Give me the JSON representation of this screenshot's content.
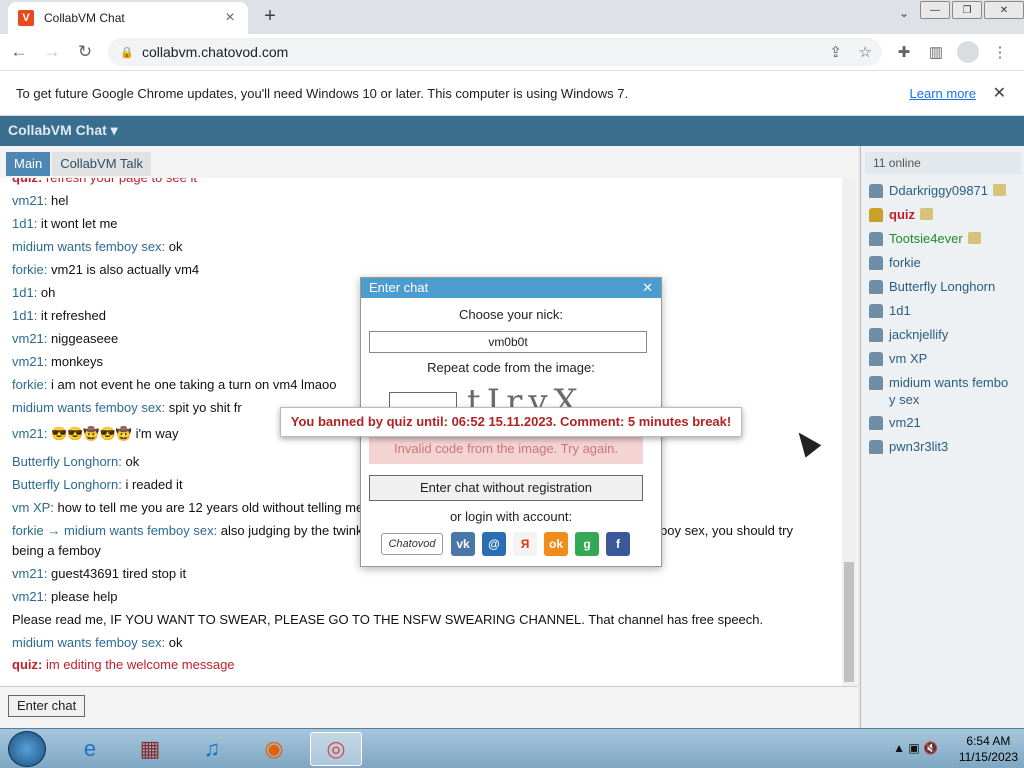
{
  "browser": {
    "tab_title": "CollabVM Chat",
    "tab_favicon": "V",
    "new_tab_label": "+",
    "url": "collabvm.chatovod.com",
    "infobar_text": "To get future Google Chrome updates, you'll need Windows 10 or later. This computer is using Windows 7.",
    "infobar_link": "Learn more"
  },
  "app": {
    "header_title": "CollabVM Chat ▾",
    "tabs": [
      {
        "label": "Main"
      },
      {
        "label": "CollabVM Talk"
      }
    ],
    "online_count": "11 online",
    "enter_chat_label": "Enter chat"
  },
  "messages": [
    {
      "nick": "quiz:",
      "text": " refresh your page to see it",
      "red": true
    },
    {
      "nick": "vm21:",
      "text": " hel"
    },
    {
      "nick": "1d1:",
      "text": " it wont let me"
    },
    {
      "nick": "midium wants femboy sex:",
      "text": " ok"
    },
    {
      "nick": "forkie:",
      "text": " vm21 is also actually vm4"
    },
    {
      "nick": "1d1:",
      "text": " oh"
    },
    {
      "nick": "1d1:",
      "text": " it refreshed"
    },
    {
      "nick": "vm21:",
      "text": " niggeaseee"
    },
    {
      "nick": "vm21:",
      "text": " monkeys"
    },
    {
      "nick": "forkie:",
      "text": " i am not event he one taking a turn on vm4 lmaoo"
    },
    {
      "nick": "midium wants femboy sex:",
      "text": " spit yo shit fr"
    },
    {
      "nick": "vm21:",
      "text": " 😎😎🤠😎🤠 i'm way"
    },
    {
      "nick": "Butterfly Longhorn:",
      "text": " ok"
    },
    {
      "nick": "Butterfly Longhorn:",
      "text": " i readed it"
    },
    {
      "nick": "vm XP:",
      "text": " how to tell me you are 12 years old without telling me"
    },
    {
      "nick": "forkie → midium wants femboy sex:",
      "text": " also judging by the twink",
      "tail": "boy sex, you should try"
    },
    {
      "nick": "",
      "text": "being a femboy"
    },
    {
      "nick": "vm21:",
      "text": " guest43691 tired stop it"
    },
    {
      "nick": "vm21:",
      "text": " please help"
    },
    {
      "nick": "",
      "text": "Please read me, IF YOU WANT TO SWEAR, PLEASE GO TO THE NSFW SWEARING CHANNEL. That channel has free speech."
    },
    {
      "nick": "midium wants femboy sex:",
      "text": " ok"
    },
    {
      "nick": "quiz:",
      "text": " im editing the welcome message",
      "red": true
    }
  ],
  "users": [
    {
      "name": "Ddarkriggy09871",
      "badge": true
    },
    {
      "name": "quiz",
      "admin": true,
      "badge": true
    },
    {
      "name": "Tootsie4ever",
      "badge": true
    },
    {
      "name": "forkie"
    },
    {
      "name": "Butterfly Longhorn"
    },
    {
      "name": "1d1"
    },
    {
      "name": "jacknjellify"
    },
    {
      "name": "vm XP"
    },
    {
      "name": "midium wants femboy sex"
    },
    {
      "name": "vm21"
    },
    {
      "name": "pwn3r3lit3"
    }
  ],
  "dialog": {
    "title": "Enter chat",
    "choose_nick_label": "Choose your nick:",
    "nick_value": "vm0b0t",
    "repeat_code_label": "Repeat code from the image:",
    "captcha_text": "tIrvX",
    "error_text": "Invalid code from the image. Try again.",
    "register_button": "Enter chat without registration",
    "login_label": "or login with account:",
    "social": [
      "Chatovod",
      "vk",
      "@",
      "Я",
      "ok",
      "g",
      "f"
    ]
  },
  "toast": "You banned by quiz until: 06:52 15.11.2023. Comment: 5 minutes break!",
  "taskbar": {
    "time": "6:54 AM",
    "date": "11/15/2023"
  },
  "colors": {
    "app_header": "#3a6e8f",
    "tab_active": "#4c88b3",
    "error": "#b02323",
    "admin_nick": "#c0202a"
  }
}
